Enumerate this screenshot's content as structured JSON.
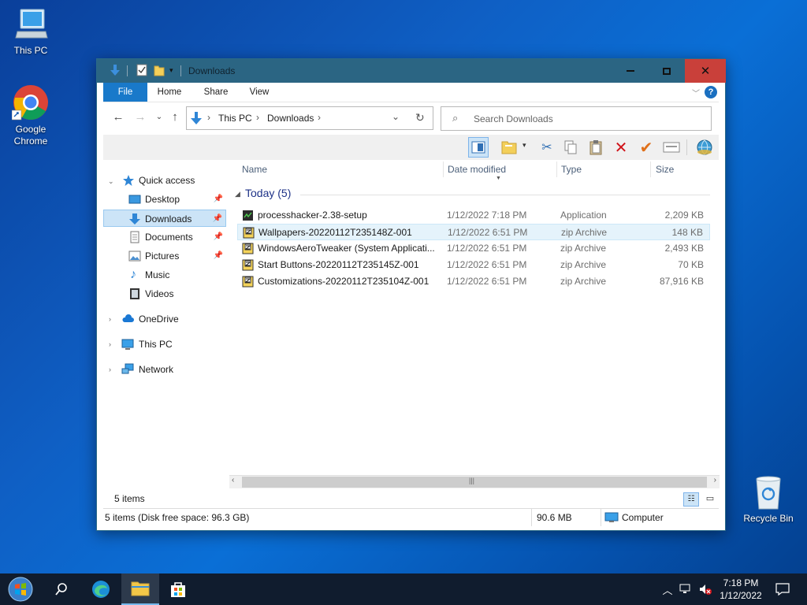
{
  "desktop": {
    "icons": [
      {
        "label": "This PC"
      },
      {
        "label": "Google Chrome"
      },
      {
        "label": "Recycle Bin"
      }
    ]
  },
  "window": {
    "title": "Downloads",
    "ribbon_tabs": [
      "File",
      "Home",
      "Share",
      "View"
    ],
    "address": {
      "crumbs": [
        "This PC",
        "Downloads"
      ]
    },
    "search": {
      "placeholder": "Search Downloads"
    },
    "nav": {
      "quick_access": "Quick access",
      "pinned": [
        {
          "label": "Desktop",
          "pinned": true
        },
        {
          "label": "Downloads",
          "pinned": true,
          "selected": true
        },
        {
          "label": "Documents",
          "pinned": true
        },
        {
          "label": "Pictures",
          "pinned": true
        },
        {
          "label": "Music",
          "pinned": false
        },
        {
          "label": "Videos",
          "pinned": false
        }
      ],
      "roots": [
        "OneDrive",
        "This PC",
        "Network"
      ]
    },
    "columns": [
      "Name",
      "Date modified",
      "Type",
      "Size"
    ],
    "group": "Today (5)",
    "files": [
      {
        "name": "processhacker-2.38-setup",
        "date": "1/12/2022 7:18 PM",
        "type": "Application",
        "size": "2,209 KB",
        "icon": "app-icon"
      },
      {
        "name": "Wallpapers-20220112T235148Z-001",
        "date": "1/12/2022 6:51 PM",
        "type": "zip Archive",
        "size": "148 KB",
        "icon": "zip-icon"
      },
      {
        "name": "WindowsAeroTweaker (System Applicati...",
        "date": "1/12/2022 6:51 PM",
        "type": "zip Archive",
        "size": "2,493 KB",
        "icon": "zip-icon"
      },
      {
        "name": "Start Buttons-20220112T235145Z-001",
        "date": "1/12/2022 6:51 PM",
        "type": "zip Archive",
        "size": "70 KB",
        "icon": "zip-icon"
      },
      {
        "name": "Customizations-20220112T235104Z-001",
        "date": "1/12/2022 6:51 PM",
        "type": "zip Archive",
        "size": "87,916 KB",
        "icon": "zip-icon"
      }
    ],
    "status": {
      "item_count": "5 items",
      "disk_info": "5 items (Disk free space: 96.3 GB)",
      "size": "90.6 MB",
      "location": "Computer"
    }
  },
  "taskbar": {
    "clock_time": "7:18 PM",
    "clock_date": "1/12/2022"
  }
}
